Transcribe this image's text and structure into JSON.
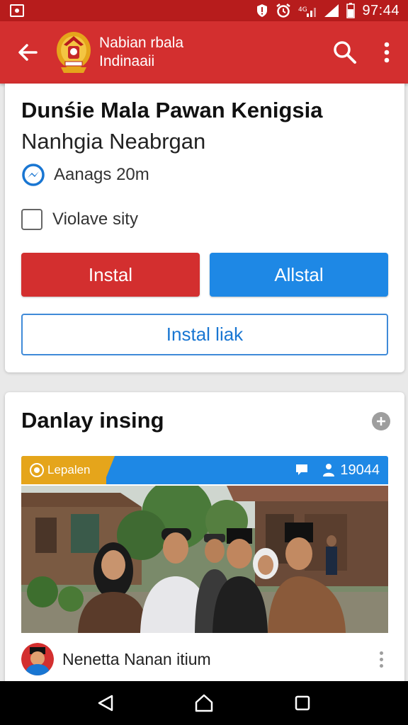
{
  "status_bar": {
    "time": "97:44",
    "icons": [
      "notification-icon",
      "shield-icon",
      "alarm-icon",
      "signal-icon",
      "wifi-icon",
      "battery-icon"
    ]
  },
  "app_bar": {
    "title_line1": "Nabian rbala",
    "title_line2": "Indinaaii",
    "icons": [
      "back-arrow-icon",
      "search-icon",
      "more-vert-icon"
    ],
    "color": "#d32f2f"
  },
  "app_card": {
    "name": "Dunśie Mala Pawan Kenigsia",
    "subtitle": "Nanhgia Neabrgan",
    "meta": "Aanags 20m",
    "checkbox_label": "Violave sity",
    "checkbox_checked": false,
    "primary_button": "Instal",
    "secondary_button": "Allstal",
    "outline_button": "Instal  liak",
    "colors": {
      "red": "#d32f2f",
      "blue": "#1e88e5"
    }
  },
  "feed_card": {
    "section_title": "Danlay insing",
    "post": {
      "tag": "Lepalen",
      "count": "19044",
      "author": "Nenetta Nanan itium"
    }
  },
  "nav_bar": {
    "icons": [
      "back-triangle-icon",
      "home-icon",
      "recents-square-icon"
    ]
  }
}
